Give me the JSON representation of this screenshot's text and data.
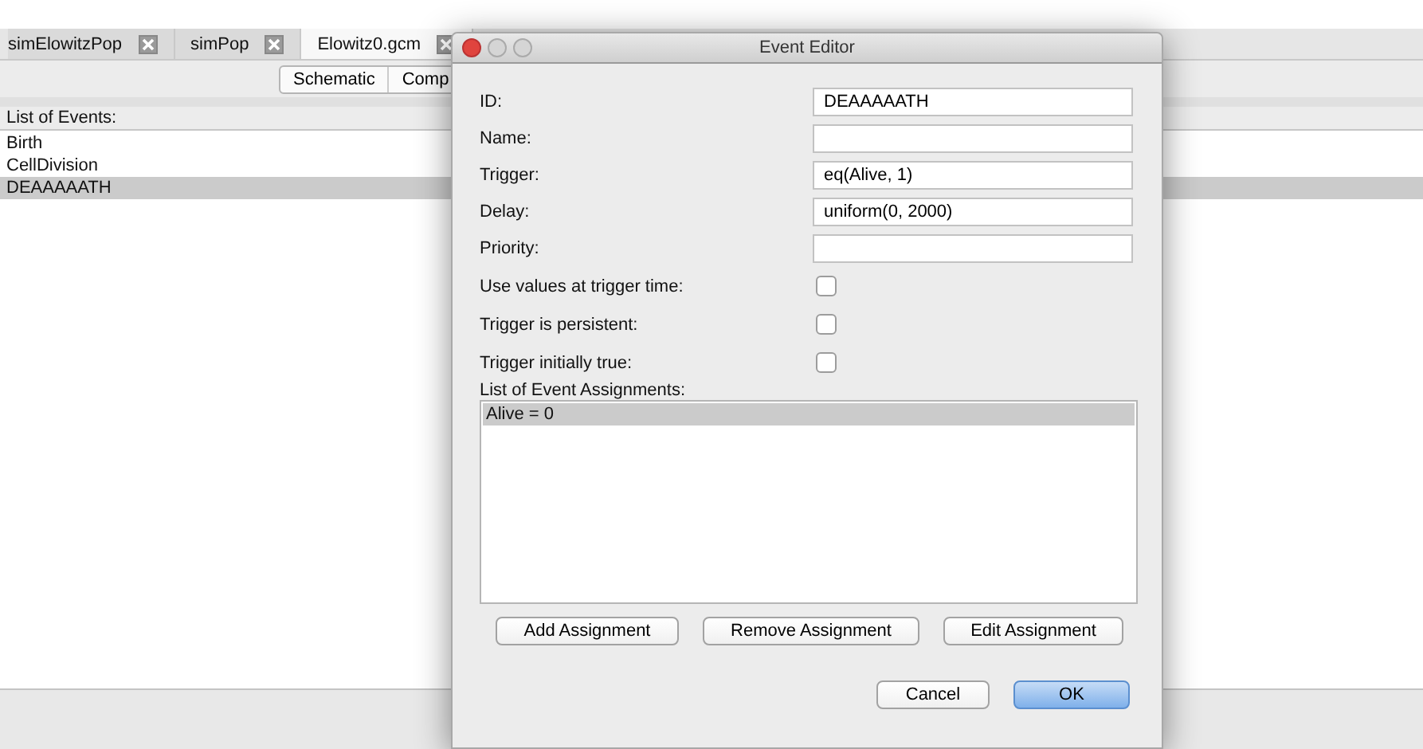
{
  "tabs": [
    {
      "label": "simElowitzPop",
      "selected": false
    },
    {
      "label": "simPop",
      "selected": false
    },
    {
      "label": "Elowitz0.gcm",
      "selected": true
    }
  ],
  "view_switch": [
    {
      "label": "Schematic",
      "selected": false
    },
    {
      "label": "Comp",
      "selected": false
    }
  ],
  "events": {
    "header": "List of Events:",
    "items": [
      {
        "label": "Birth",
        "selected": false
      },
      {
        "label": "CellDivision",
        "selected": false
      },
      {
        "label": "DEAAAAATH",
        "selected": true
      }
    ]
  },
  "dialog": {
    "title": "Event Editor",
    "fields": [
      {
        "label": "ID:",
        "value": "DEAAAAATH"
      },
      {
        "label": "Name:"
      },
      {
        "label": "Trigger:",
        "value": "eq(Alive, 1)"
      },
      {
        "label": "Delay:",
        "value": "uniform(0, 2000)"
      },
      {
        "label": "Priority:"
      }
    ],
    "checkboxes": [
      {
        "label": "Use values at trigger time:",
        "checked": false
      },
      {
        "label": "Trigger is persistent:",
        "checked": false
      },
      {
        "label": "Trigger initially true:",
        "checked": false
      }
    ],
    "assignments": {
      "header": "List of Event Assignments:",
      "items": [
        {
          "label": "Alive = 0",
          "selected": true
        }
      ]
    },
    "assignment_buttons": [
      "Add Assignment",
      "Remove Assignment",
      "Edit Assignment"
    ],
    "buttons": [
      {
        "label": "Cancel",
        "default": false
      },
      {
        "label": "OK",
        "default": true
      }
    ]
  }
}
